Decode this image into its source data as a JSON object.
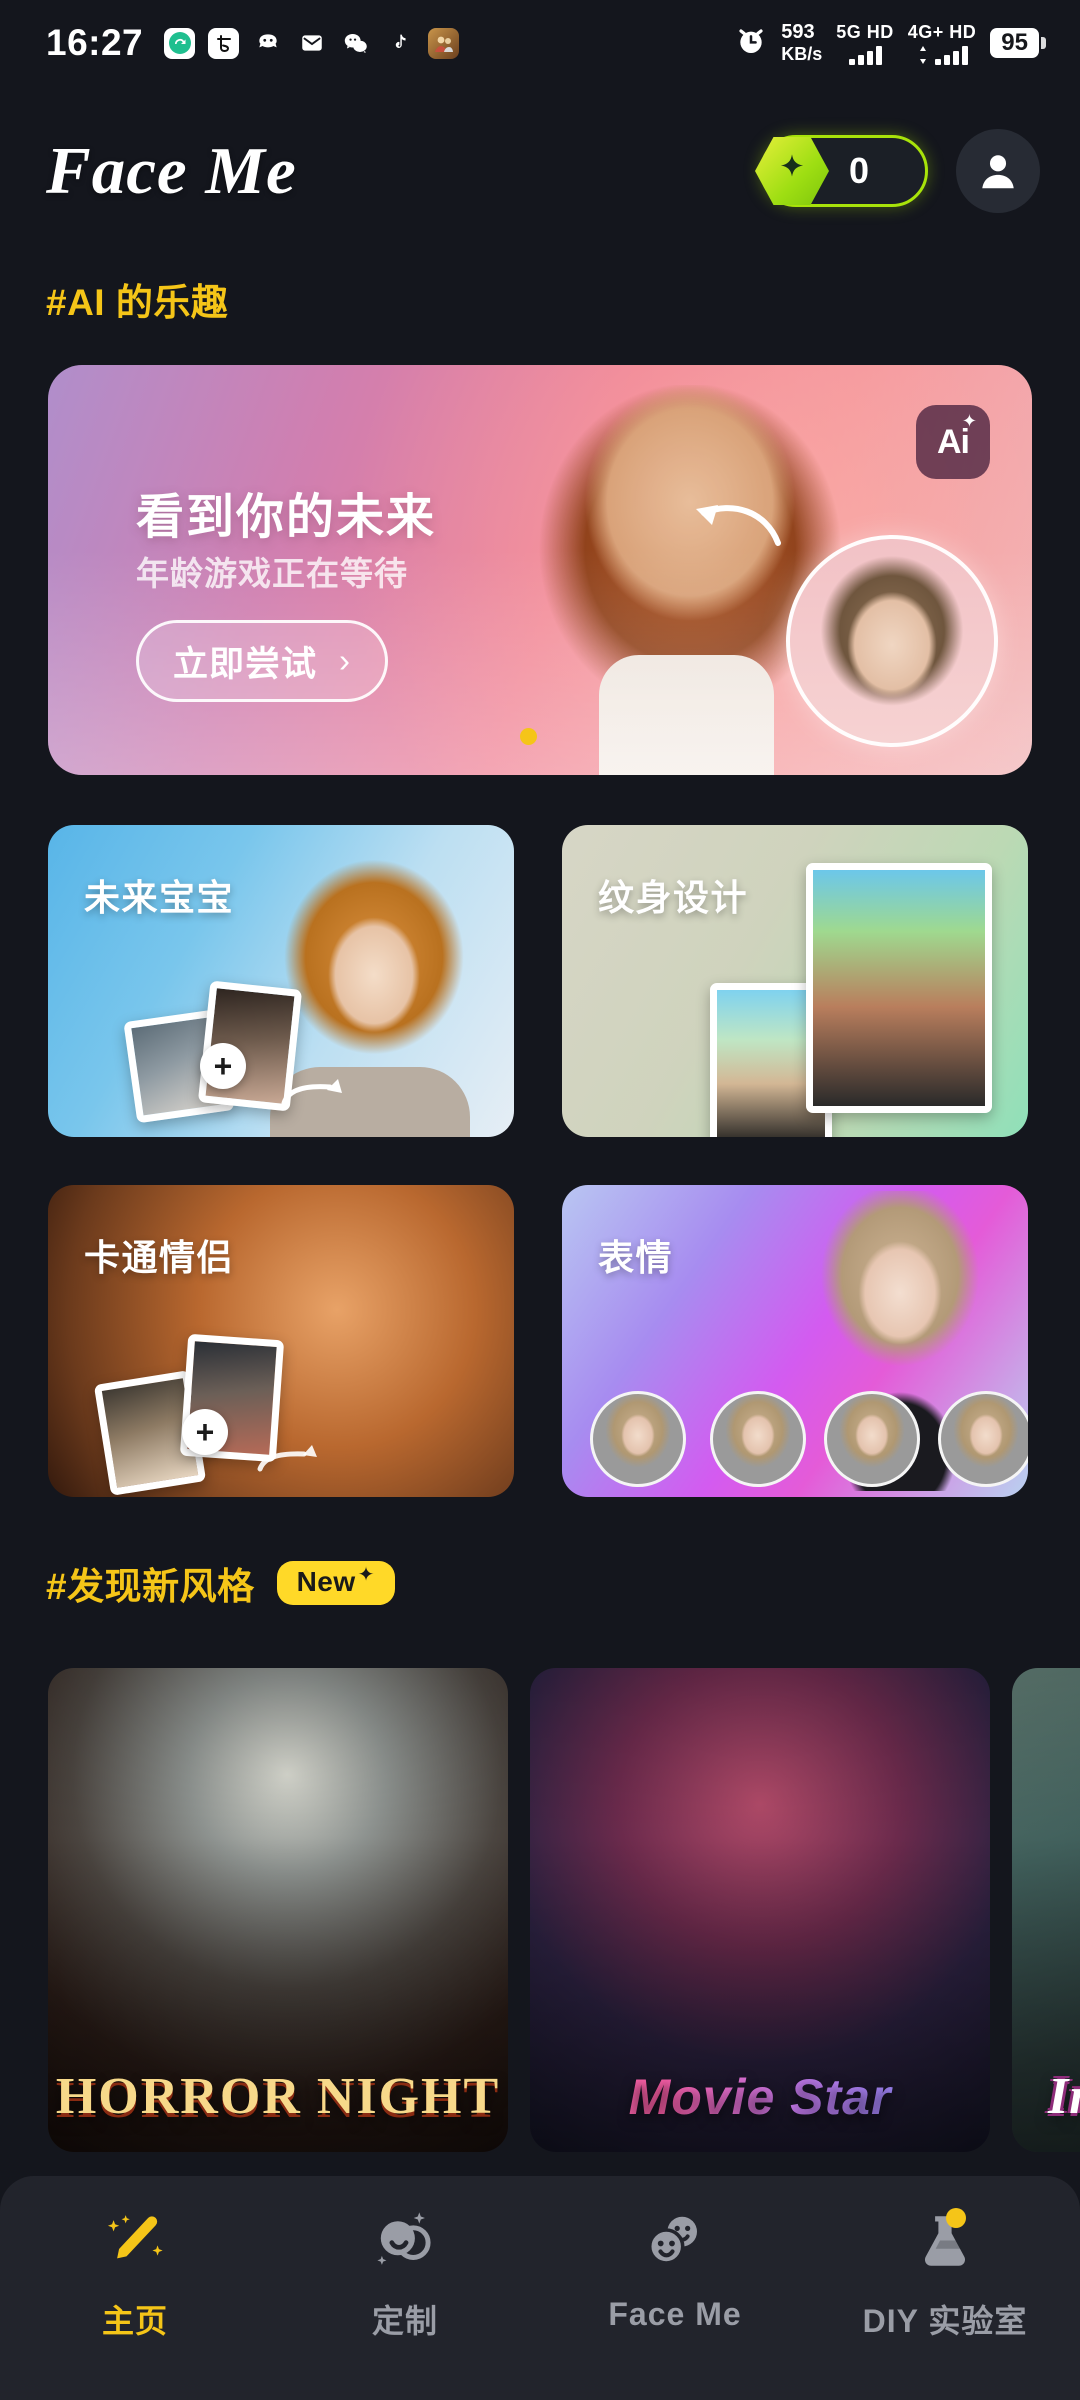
{
  "status_bar": {
    "time": "16:27",
    "app_icons": [
      "sync-icon",
      "alipay-icon",
      "game-helper-icon",
      "mail-icon",
      "wechat-icon",
      "tiktok-icon",
      "game-app-icon"
    ],
    "alarm_icon": "alarm-clock-icon",
    "network_speed": "593",
    "network_speed_unit": "KB/s",
    "sim1_label": "5G HD",
    "sim2_label": "4G+ HD",
    "battery_percent": "95"
  },
  "header": {
    "brand": "Face Me",
    "credits_count": "0",
    "credits_icon": "spark-gem-icon",
    "avatar_icon": "person-icon"
  },
  "sections": {
    "ai_fun_title": "#AI 的乐趣",
    "discover_title": "#发现新风格",
    "discover_badge": "New",
    "discover_badge_spark": "✦"
  },
  "hero": {
    "title": "看到你的未来",
    "subtitle": "年龄游戏正在等待",
    "cta_label": "立即尝试",
    "cta_chevron": "›",
    "ai_badge": "Ai",
    "ai_badge_spark": "✦"
  },
  "features": [
    {
      "label": "未来宝宝",
      "name": "future-baby"
    },
    {
      "label": "纹身设计",
      "name": "tattoo-design"
    },
    {
      "label": "卡通情侣",
      "name": "cartoon-couple"
    },
    {
      "label": "表情",
      "name": "expression"
    }
  ],
  "styles": [
    {
      "caption": "HORROR NIGHT",
      "name": "horror-night"
    },
    {
      "caption": "Movie Star",
      "name": "movie-star"
    },
    {
      "caption": "Insta",
      "name": "insta"
    }
  ],
  "bottom_nav": [
    {
      "label": "主页",
      "icon": "magic-wand-icon",
      "active": true
    },
    {
      "label": "定制",
      "icon": "faces-sparkle-icon",
      "active": false
    },
    {
      "label": "Face Me",
      "icon": "smiley-faces-icon",
      "active": false
    },
    {
      "label": "DIY 实验室",
      "icon": "flask-icon",
      "active": false
    }
  ],
  "colors": {
    "background": "#14161d",
    "accent_yellow": "#f5c518",
    "credits_green": "#a8e30a",
    "nav_bar": "#22242c",
    "nav_inactive": "#9a9da6"
  }
}
